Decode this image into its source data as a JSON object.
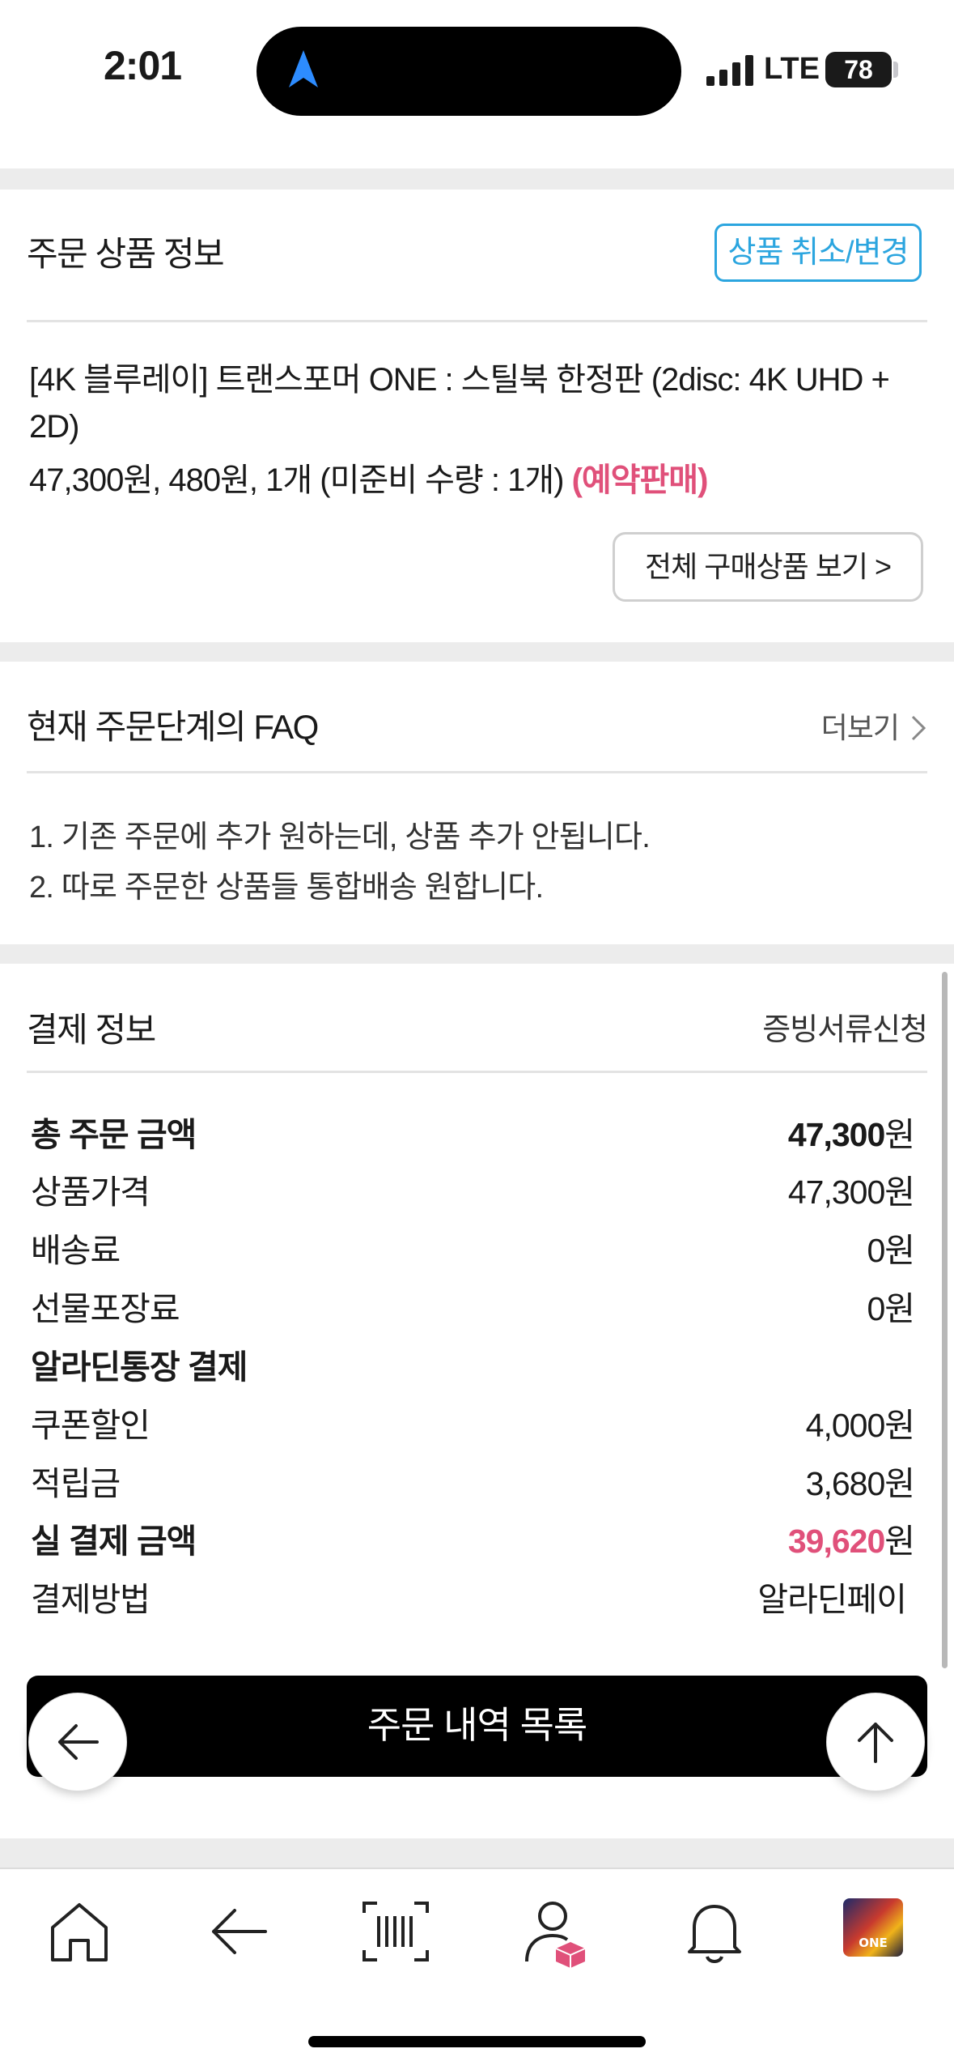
{
  "status_bar": {
    "time": "2:01",
    "network": "LTE",
    "battery": "78"
  },
  "product_section": {
    "title": "주문 상품 정보",
    "cancel_button": "상품 취소/변경",
    "product_name": "[4K 블루레이] 트랜스포머 ONE : 스틸북 한정판 (2disc: 4K UHD + 2D)",
    "price_line": "47,300원, 480원, 1개 (미준비 수량 : 1개) ",
    "preorder_tag": "(예약판매)",
    "view_all_button": "전체 구매상품 보기 >"
  },
  "faq_section": {
    "title": "현재 주문단계의 FAQ",
    "more_label": "더보기",
    "items": [
      "1. 기존 주문에 추가 원하는데, 상품 추가 안됩니다.",
      "2. 따로 주문한 상품들 통합배송 원합니다."
    ]
  },
  "payment_section": {
    "title": "결제 정보",
    "receipt_link": "증빙서류신청",
    "total_label": "총 주문 금액",
    "total_amount": "47,300",
    "total_unit": "원",
    "product_price_label": "상품가격",
    "product_price": "47,300원",
    "shipping_label": "배송료",
    "shipping": "0원",
    "gift_wrap_label": "선물포장료",
    "gift_wrap": "0원",
    "account_label": "알라딘통장 결제",
    "coupon_label": "쿠폰할인",
    "coupon": "4,000원",
    "points_label": "적립금",
    "points": "3,680원",
    "actual_label": "실 결제 금액",
    "actual_amount": "39,620",
    "actual_unit": "원",
    "method_label": "결제방법",
    "method": "알라딘페이"
  },
  "order_list_button": "주문 내역 목록",
  "tab_bar": {
    "icons": [
      "home-icon",
      "back-arrow-icon",
      "barcode-scan-icon",
      "my-account-icon",
      "bell-icon",
      "cart-thumbnail"
    ],
    "cart_thumbnail_text": "ONE"
  },
  "colors": {
    "accent_blue": "#2ba5df",
    "accent_pink": "#e0507a",
    "button_black": "#000000"
  }
}
